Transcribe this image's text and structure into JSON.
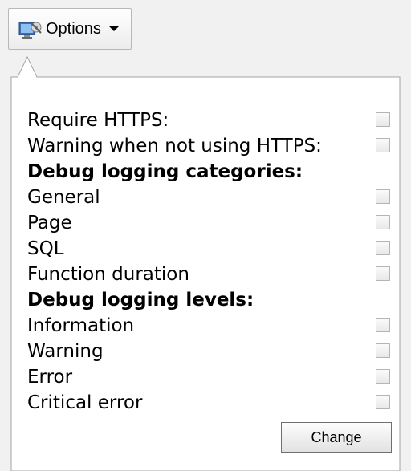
{
  "toolbar": {
    "options_label": "Options"
  },
  "settings": {
    "rows": [
      {
        "label": "Require HTTPS:",
        "checked": false
      },
      {
        "label": "Warning when not using HTTPS:",
        "checked": false
      }
    ],
    "categories_heading": "Debug logging categories:",
    "categories": [
      {
        "label": "General",
        "checked": false
      },
      {
        "label": "Page",
        "checked": false
      },
      {
        "label": "SQL",
        "checked": false
      },
      {
        "label": "Function duration",
        "checked": false
      }
    ],
    "levels_heading": "Debug logging levels:",
    "levels": [
      {
        "label": "Information",
        "checked": false
      },
      {
        "label": "Warning",
        "checked": false
      },
      {
        "label": "Error",
        "checked": false
      },
      {
        "label": "Critical error",
        "checked": false
      }
    ],
    "change_label": "Change"
  },
  "colors": {
    "background": "#f1f1f1",
    "panel": "#ffffff",
    "panel_border": "#a3a3a3",
    "checkbox_border": "#b5b5b5"
  }
}
